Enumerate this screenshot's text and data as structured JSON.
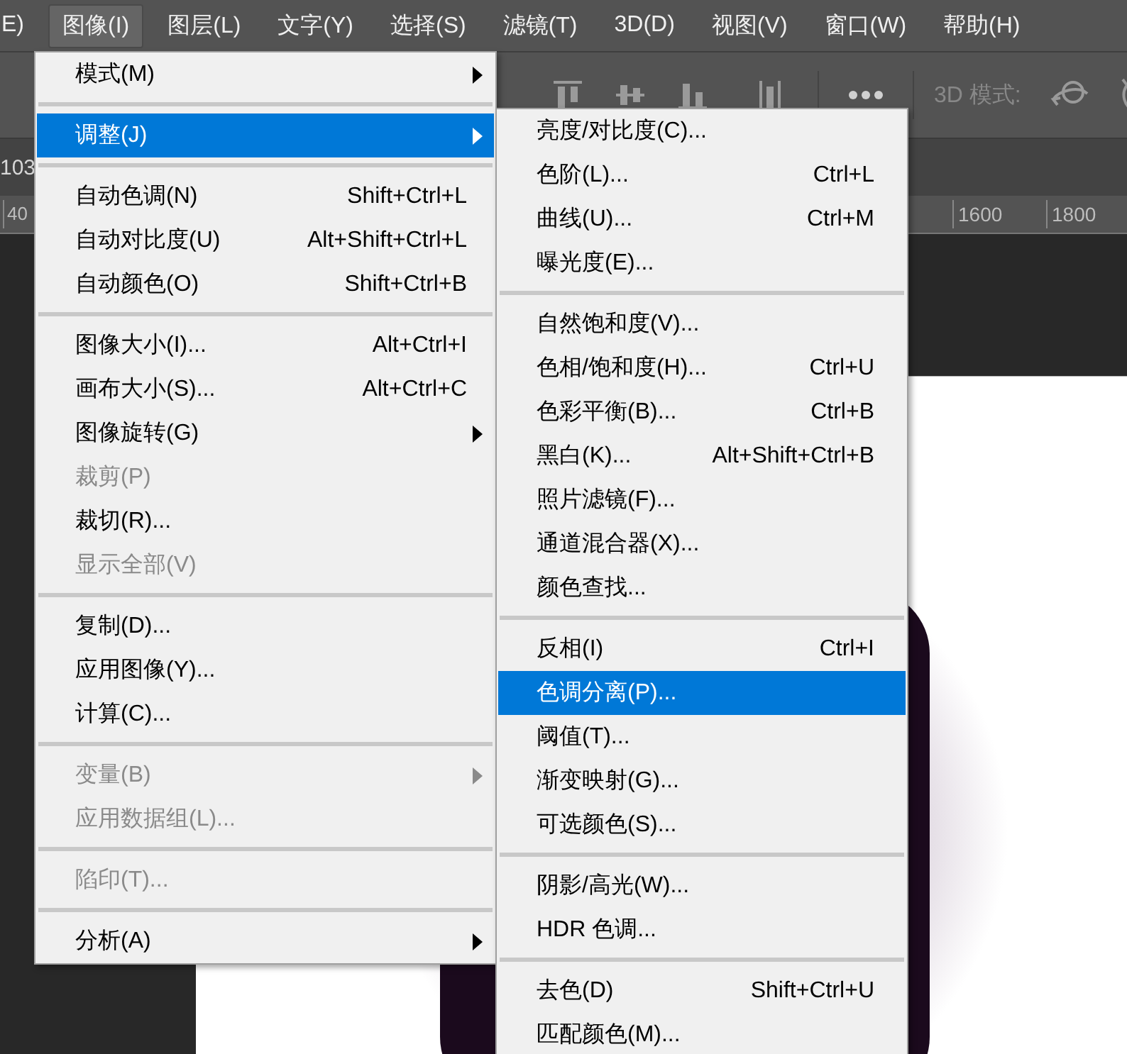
{
  "menu_bar": {
    "items": [
      {
        "label": "E)",
        "selected": false
      },
      {
        "label": "图像(I)",
        "selected": true
      },
      {
        "label": "图层(L)",
        "selected": false
      },
      {
        "label": "文字(Y)",
        "selected": false
      },
      {
        "label": "选择(S)",
        "selected": false
      },
      {
        "label": "滤镜(T)",
        "selected": false
      },
      {
        "label": "3D(D)",
        "selected": false
      },
      {
        "label": "视图(V)",
        "selected": false
      },
      {
        "label": "窗口(W)",
        "selected": false
      },
      {
        "label": "帮助(H)",
        "selected": false
      }
    ]
  },
  "options_bar": {
    "mode_label": "3D 模式:"
  },
  "document_tab": {
    "title": "103"
  },
  "ruler": {
    "labels": [
      "40",
      "1600",
      "1800"
    ]
  },
  "image_menu": {
    "items": [
      {
        "kind": "item",
        "label": "模式(M)",
        "submenu": true,
        "disabled": false,
        "selected": false
      },
      {
        "kind": "separator"
      },
      {
        "kind": "item",
        "label": "调整(J)",
        "submenu": true,
        "disabled": false,
        "selected": true
      },
      {
        "kind": "separator"
      },
      {
        "kind": "item",
        "label": "自动色调(N)",
        "shortcut": "Shift+Ctrl+L",
        "submenu": false,
        "disabled": false,
        "selected": false
      },
      {
        "kind": "item",
        "label": "自动对比度(U)",
        "shortcut": "Alt+Shift+Ctrl+L",
        "submenu": false,
        "disabled": false,
        "selected": false
      },
      {
        "kind": "item",
        "label": "自动颜色(O)",
        "shortcut": "Shift+Ctrl+B",
        "submenu": false,
        "disabled": false,
        "selected": false
      },
      {
        "kind": "separator"
      },
      {
        "kind": "item",
        "label": "图像大小(I)...",
        "shortcut": "Alt+Ctrl+I",
        "submenu": false,
        "disabled": false,
        "selected": false
      },
      {
        "kind": "item",
        "label": "画布大小(S)...",
        "shortcut": "Alt+Ctrl+C",
        "submenu": false,
        "disabled": false,
        "selected": false
      },
      {
        "kind": "item",
        "label": "图像旋转(G)",
        "submenu": true,
        "disabled": false,
        "selected": false
      },
      {
        "kind": "item",
        "label": "裁剪(P)",
        "submenu": false,
        "disabled": true,
        "selected": false
      },
      {
        "kind": "item",
        "label": "裁切(R)...",
        "submenu": false,
        "disabled": false,
        "selected": false
      },
      {
        "kind": "item",
        "label": "显示全部(V)",
        "submenu": false,
        "disabled": true,
        "selected": false
      },
      {
        "kind": "separator"
      },
      {
        "kind": "item",
        "label": "复制(D)...",
        "submenu": false,
        "disabled": false,
        "selected": false
      },
      {
        "kind": "item",
        "label": "应用图像(Y)...",
        "submenu": false,
        "disabled": false,
        "selected": false
      },
      {
        "kind": "item",
        "label": "计算(C)...",
        "submenu": false,
        "disabled": false,
        "selected": false
      },
      {
        "kind": "separator"
      },
      {
        "kind": "item",
        "label": "变量(B)",
        "submenu": true,
        "disabled": true,
        "selected": false
      },
      {
        "kind": "item",
        "label": "应用数据组(L)...",
        "submenu": false,
        "disabled": true,
        "selected": false
      },
      {
        "kind": "separator"
      },
      {
        "kind": "item",
        "label": "陷印(T)...",
        "submenu": false,
        "disabled": true,
        "selected": false
      },
      {
        "kind": "separator"
      },
      {
        "kind": "item",
        "label": "分析(A)",
        "submenu": true,
        "disabled": false,
        "selected": false
      }
    ]
  },
  "adjustments_menu": {
    "items": [
      {
        "kind": "item",
        "label": "亮度/对比度(C)...",
        "disabled": false,
        "selected": false
      },
      {
        "kind": "item",
        "label": "色阶(L)...",
        "shortcut": "Ctrl+L",
        "disabled": false,
        "selected": false
      },
      {
        "kind": "item",
        "label": "曲线(U)...",
        "shortcut": "Ctrl+M",
        "disabled": false,
        "selected": false
      },
      {
        "kind": "item",
        "label": "曝光度(E)...",
        "disabled": false,
        "selected": false
      },
      {
        "kind": "separator"
      },
      {
        "kind": "item",
        "label": "自然饱和度(V)...",
        "disabled": false,
        "selected": false
      },
      {
        "kind": "item",
        "label": "色相/饱和度(H)...",
        "shortcut": "Ctrl+U",
        "disabled": false,
        "selected": false
      },
      {
        "kind": "item",
        "label": "色彩平衡(B)...",
        "shortcut": "Ctrl+B",
        "disabled": false,
        "selected": false
      },
      {
        "kind": "item",
        "label": "黑白(K)...",
        "shortcut": "Alt+Shift+Ctrl+B",
        "disabled": false,
        "selected": false
      },
      {
        "kind": "item",
        "label": "照片滤镜(F)...",
        "disabled": false,
        "selected": false
      },
      {
        "kind": "item",
        "label": "通道混合器(X)...",
        "disabled": false,
        "selected": false
      },
      {
        "kind": "item",
        "label": "颜色查找...",
        "disabled": false,
        "selected": false
      },
      {
        "kind": "separator"
      },
      {
        "kind": "item",
        "label": "反相(I)",
        "shortcut": "Ctrl+I",
        "disabled": false,
        "selected": false
      },
      {
        "kind": "item",
        "label": "色调分离(P)...",
        "disabled": false,
        "selected": true
      },
      {
        "kind": "item",
        "label": "阈值(T)...",
        "disabled": false,
        "selected": false
      },
      {
        "kind": "item",
        "label": "渐变映射(G)...",
        "disabled": false,
        "selected": false
      },
      {
        "kind": "item",
        "label": "可选颜色(S)...",
        "disabled": false,
        "selected": false
      },
      {
        "kind": "separator"
      },
      {
        "kind": "item",
        "label": "阴影/高光(W)...",
        "disabled": false,
        "selected": false
      },
      {
        "kind": "item",
        "label": "HDR 色调...",
        "disabled": false,
        "selected": false
      },
      {
        "kind": "separator"
      },
      {
        "kind": "item",
        "label": "去色(D)",
        "shortcut": "Shift+Ctrl+U",
        "disabled": false,
        "selected": false
      },
      {
        "kind": "item",
        "label": "匹配颜色(M)...",
        "disabled": false,
        "selected": false
      }
    ]
  }
}
